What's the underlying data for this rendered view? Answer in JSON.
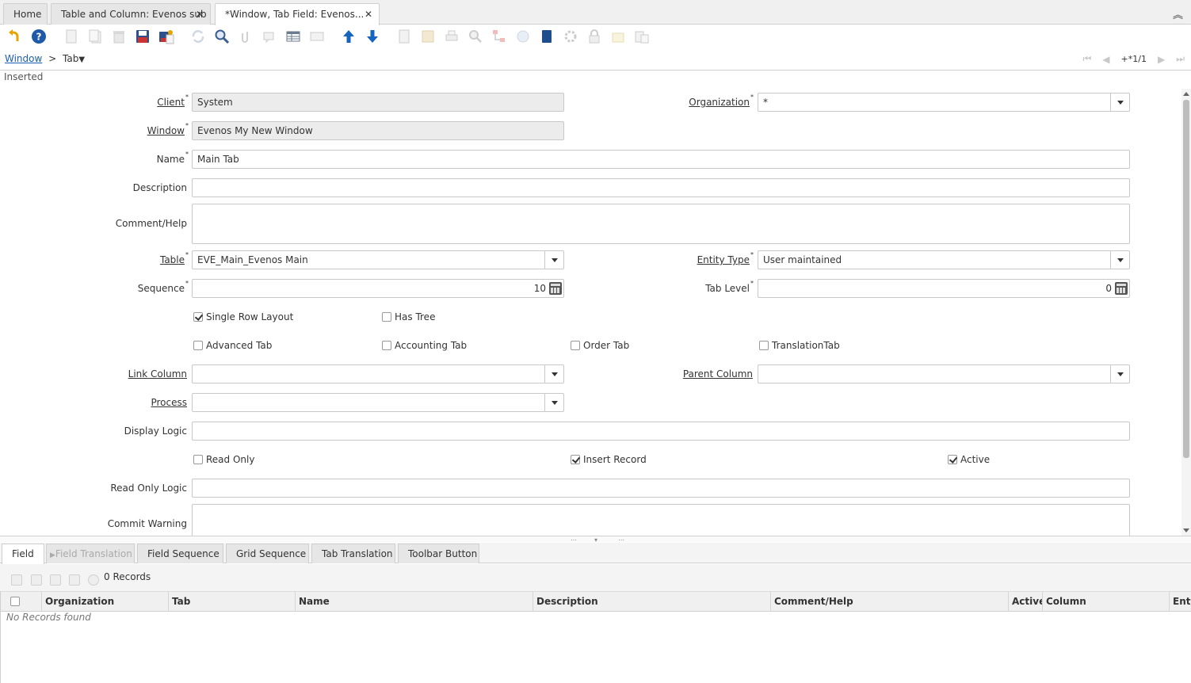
{
  "tabs": [
    {
      "label": "Home"
    },
    {
      "label": "Table and Column: Evenos sub",
      "closable": true
    },
    {
      "label": "*Window, Tab Field: Evenos...",
      "closable": true,
      "active": true
    }
  ],
  "toolbar": {
    "icons": [
      "undo-icon",
      "help-icon",
      "new-record-icon",
      "copy-record-icon",
      "delete-icon",
      "save-icon",
      "save-and-new-icon",
      "refresh-icon",
      "find-icon",
      "attachment-icon",
      "chat-icon",
      "grid-toggle-icon",
      "multi-edit-icon",
      "parent-record-icon",
      "detail-record-icon",
      "report-icon",
      "archive-icon",
      "print-icon",
      "zoom-across-icon",
      "active-workflows-icon",
      "requests-icon",
      "product-info-icon",
      "process-icon",
      "lock-icon",
      "post-icon",
      "customize-icon",
      "export-icon"
    ]
  },
  "breadcrumb": {
    "window_link": "Window",
    "separator": ">",
    "current": "Tab"
  },
  "navigation": {
    "record_indicator": "+*1/1"
  },
  "status": {
    "message": "Inserted"
  },
  "form": {
    "client": {
      "label": "Client",
      "value": "System"
    },
    "organization": {
      "label": "Organization",
      "value": "*"
    },
    "window": {
      "label": "Window",
      "value": "Evenos My New Window"
    },
    "name": {
      "label": "Name",
      "value": "Main Tab"
    },
    "description": {
      "label": "Description",
      "value": ""
    },
    "comment_help": {
      "label": "Comment/Help",
      "value": ""
    },
    "table": {
      "label": "Table",
      "value": "EVE_Main_Evenos Main"
    },
    "entity_type": {
      "label": "Entity Type",
      "value": "User maintained"
    },
    "sequence": {
      "label": "Sequence",
      "value": "10"
    },
    "tab_level": {
      "label": "Tab Level",
      "value": "0"
    },
    "single_row_layout": {
      "label": "Single Row Layout",
      "checked": true
    },
    "has_tree": {
      "label": "Has Tree",
      "checked": false
    },
    "advanced_tab": {
      "label": "Advanced Tab",
      "checked": false
    },
    "accounting_tab": {
      "label": "Accounting Tab",
      "checked": false
    },
    "order_tab": {
      "label": "Order Tab",
      "checked": false
    },
    "translation_tab": {
      "label": "TranslationTab",
      "checked": false
    },
    "link_column": {
      "label": "Link Column",
      "value": ""
    },
    "parent_column": {
      "label": "Parent Column",
      "value": ""
    },
    "process": {
      "label": "Process",
      "value": ""
    },
    "display_logic": {
      "label": "Display Logic",
      "value": ""
    },
    "read_only": {
      "label": "Read Only",
      "checked": false
    },
    "insert_record": {
      "label": "Insert Record",
      "checked": true
    },
    "active": {
      "label": "Active",
      "checked": true
    },
    "read_only_logic": {
      "label": "Read Only Logic",
      "value": ""
    },
    "commit_warning": {
      "label": "Commit Warning",
      "value": ""
    }
  },
  "detail_tabs": [
    {
      "label": "Field",
      "active": true
    },
    {
      "label": "Field Translation",
      "disabled": true
    },
    {
      "label": "Field Sequence"
    },
    {
      "label": "Grid Sequence"
    },
    {
      "label": "Tab Translation"
    },
    {
      "label": "Toolbar Button"
    }
  ],
  "detail": {
    "record_count": "0 Records",
    "columns": [
      "Organization",
      "Tab",
      "Name",
      "Description",
      "Comment/Help",
      "Active",
      "Column",
      "Enti"
    ],
    "empty_message": "No Records found"
  },
  "colors": {
    "link": "#1a5fb4",
    "nav_arrow": "#1565c0",
    "readonly_bg": "#ececec"
  }
}
